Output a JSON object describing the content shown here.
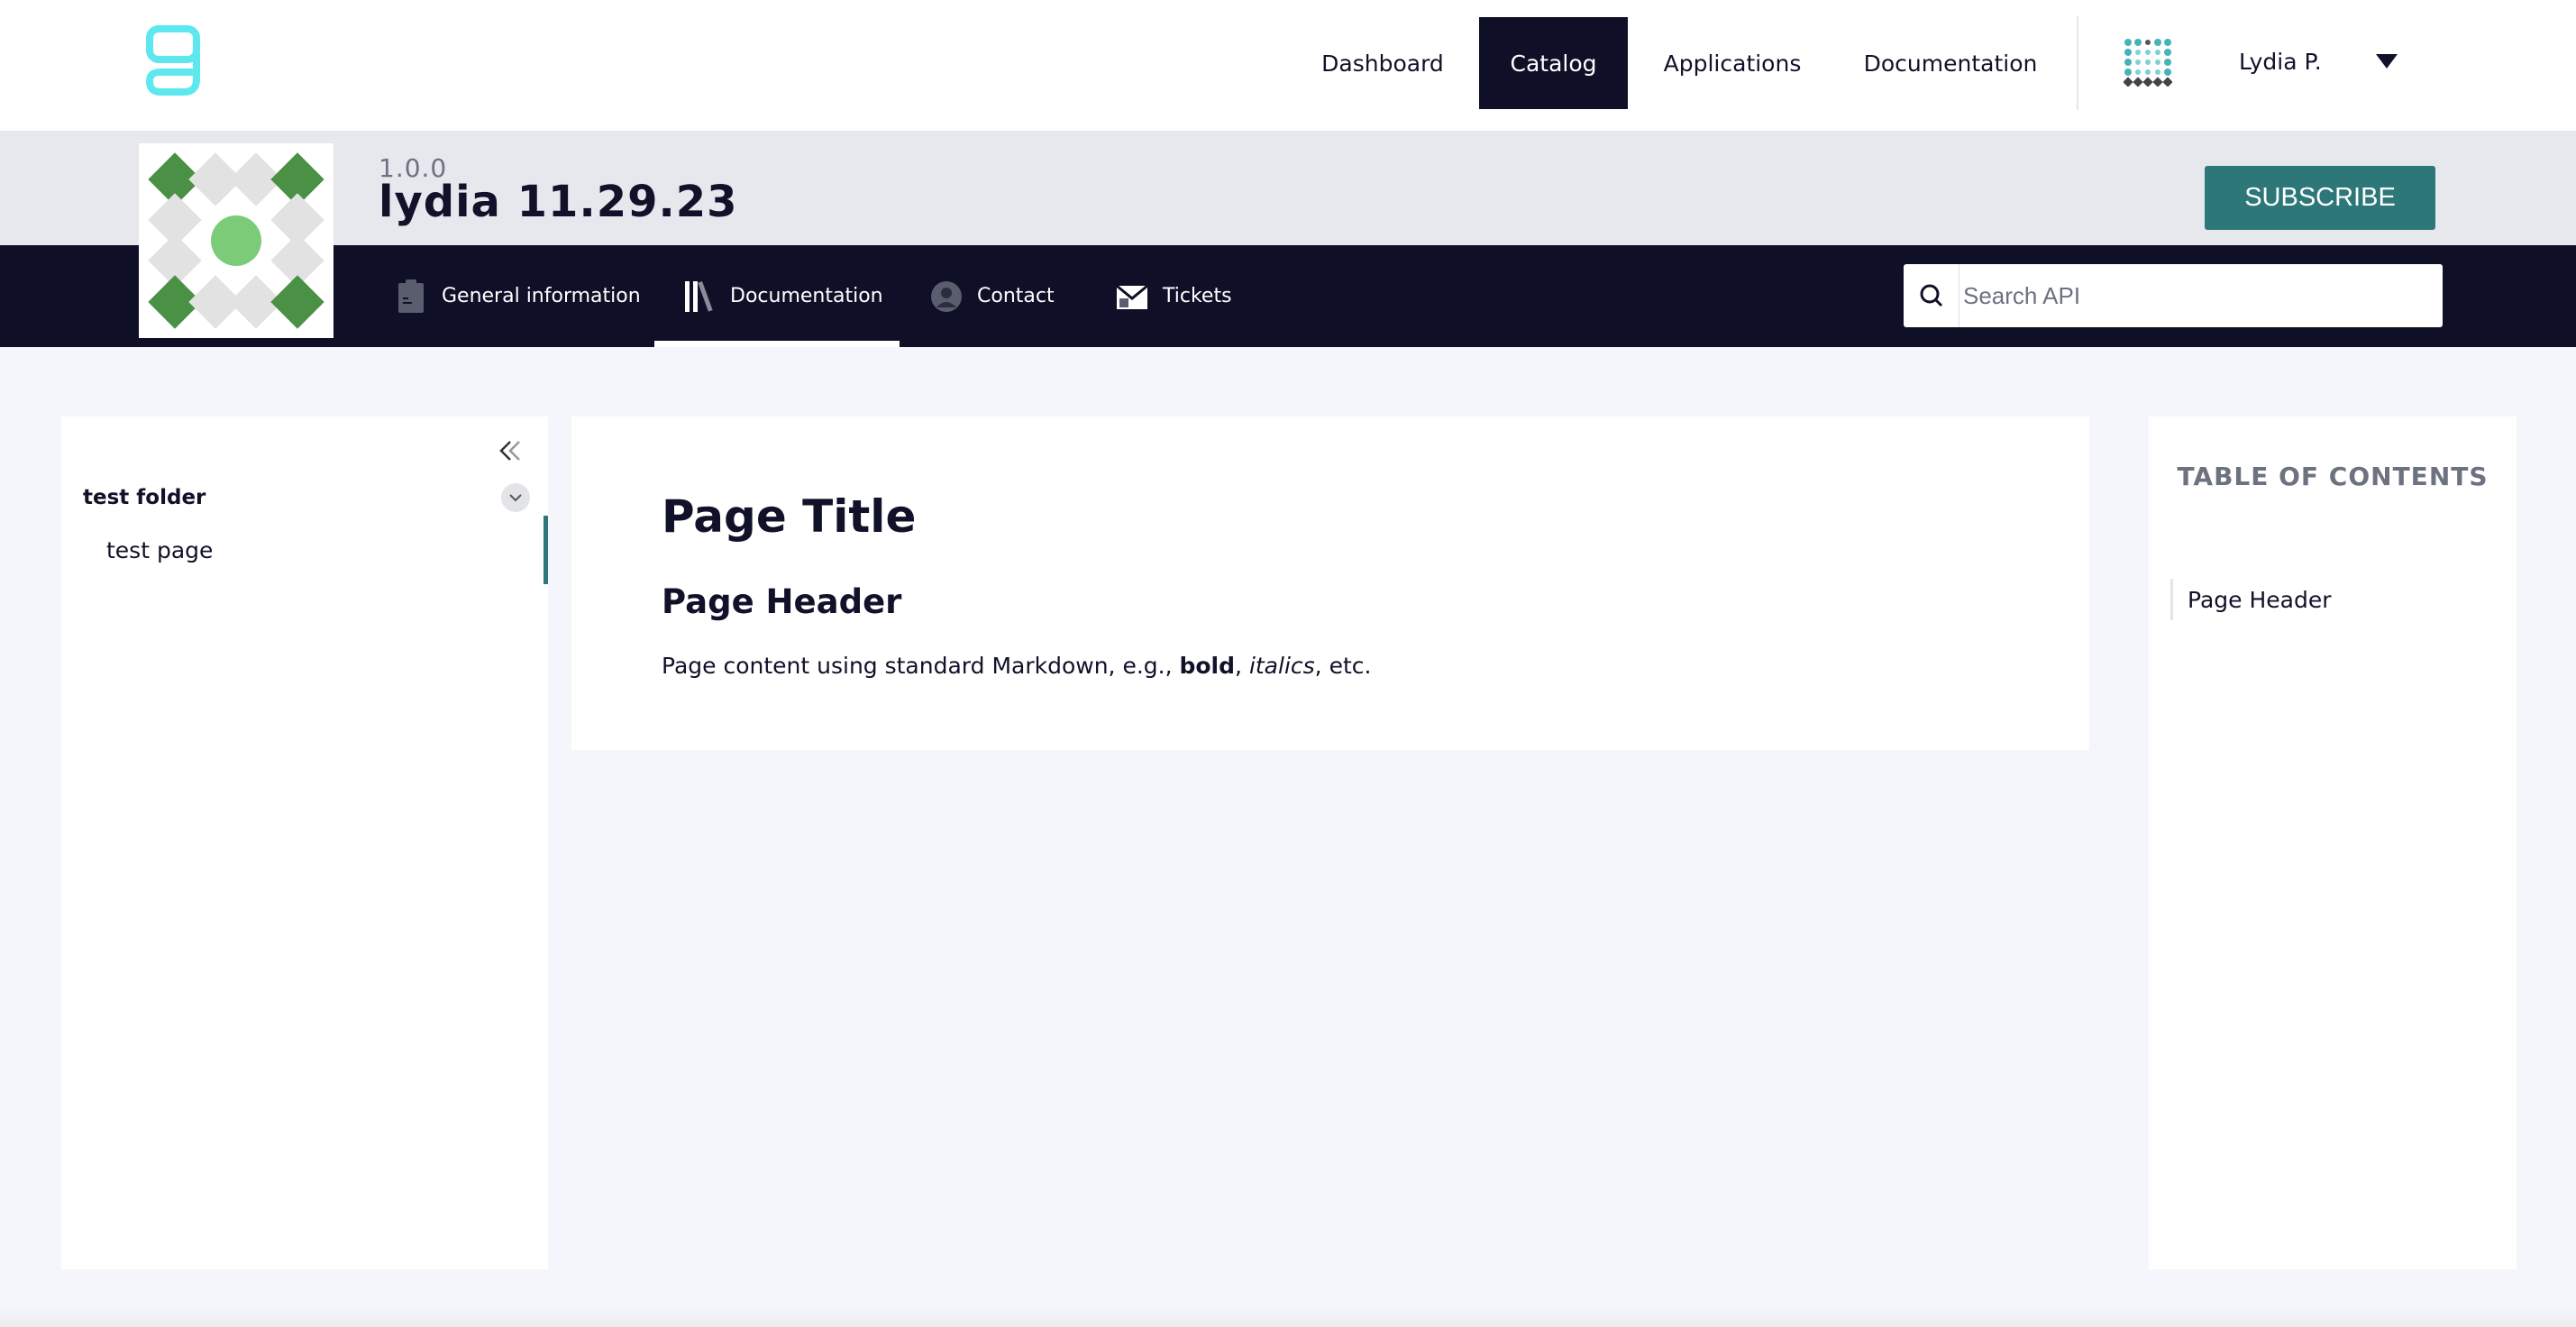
{
  "topnav": {
    "items": [
      {
        "label": "Dashboard",
        "active": false
      },
      {
        "label": "Catalog",
        "active": true
      },
      {
        "label": "Applications",
        "active": false
      },
      {
        "label": "Documentation",
        "active": false
      }
    ],
    "user": {
      "name": "Lydia P."
    }
  },
  "api": {
    "version": "1.0.0",
    "name": "lydia 11.29.23",
    "subscribe_label": "SUBSCRIBE"
  },
  "tabs": [
    {
      "label": "General information",
      "icon": "clipboard-icon",
      "active": false
    },
    {
      "label": "Documentation",
      "icon": "books-icon",
      "active": true
    },
    {
      "label": "Contact",
      "icon": "person-icon",
      "active": false
    },
    {
      "label": "Tickets",
      "icon": "envelope-icon",
      "active": false
    }
  ],
  "search": {
    "placeholder": "Search API",
    "value": ""
  },
  "sidebar": {
    "folder": {
      "label": "test folder",
      "expanded": true
    },
    "pages": [
      {
        "label": "test page",
        "selected": true
      }
    ]
  },
  "content": {
    "title": "Page Title",
    "header": "Page Header",
    "body": {
      "prefix": "Page content using standard Markdown, e.g., ",
      "bold": "bold",
      "sep": ", ",
      "italic": "italics",
      "suffix": ", etc."
    }
  },
  "toc": {
    "title": "TABLE OF CONTENTS",
    "items": [
      {
        "label": "Page Header"
      }
    ]
  },
  "colors": {
    "brand_cyan": "#5ce8ee",
    "nav_dark": "#0f1027",
    "accent_teal": "#2e7778",
    "logo_green": "#4a9145",
    "logo_light_green": "#7ccb78"
  }
}
